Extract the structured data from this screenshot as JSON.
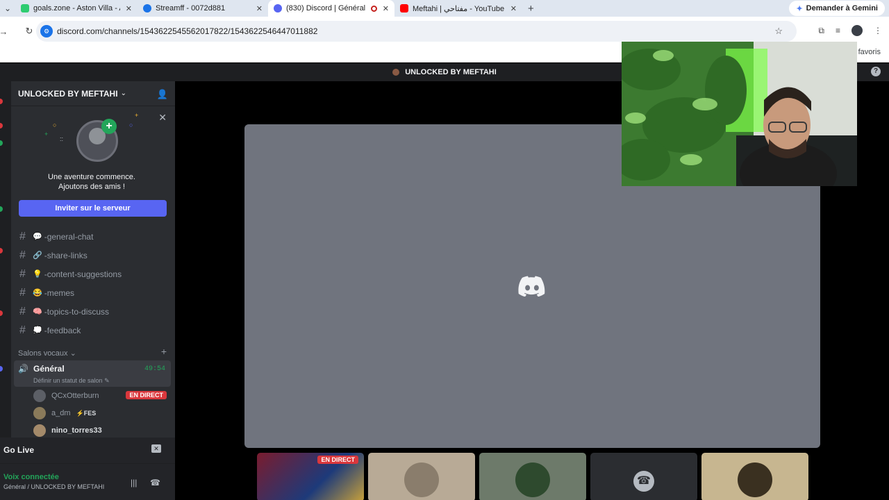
{
  "browser": {
    "tabs": [
      {
        "label": "goals.zone - Aston Villa - Ars",
        "icon": "goals-favicon",
        "color": "#2ecc71",
        "active": false
      },
      {
        "label": "Streamff - 0072d881",
        "icon": "streamff-favicon",
        "color": "#1a73e8",
        "active": false
      },
      {
        "label": "(830) Discord | Général |",
        "icon": "discord-favicon",
        "color": "#5865f2",
        "active": true
      },
      {
        "label": "Meftahi | مفتاحي - YouTube",
        "icon": "youtube-favicon",
        "color": "#ff0000",
        "active": false
      }
    ],
    "gemini_label": "Demander à Gemini",
    "url": "discord.com/channels/1543622545562017822/1543622546447011882",
    "bookmarks_label": "s favoris"
  },
  "discord": {
    "top_title": "UNLOCKED BY MEFTAHI",
    "server_name": "UNLOCKED BY MEFTAHI",
    "promo": {
      "line1": "Une aventure commence.",
      "line2": "Ajoutons des amis !",
      "button": "Inviter sur le serveur"
    },
    "channels": [
      {
        "emoji": "💬",
        "name": "-general-chat"
      },
      {
        "emoji": "🔗",
        "name": "-share-links"
      },
      {
        "emoji": "💡",
        "name": "-content-suggestions"
      },
      {
        "emoji": "😂",
        "name": "-memes"
      },
      {
        "emoji": "🧠",
        "name": "-topics-to-discuss"
      },
      {
        "emoji": "💭",
        "name": "-feedback"
      }
    ],
    "voice_category": "Salons vocaux",
    "voice_channel": {
      "name": "Général",
      "time": "49:54",
      "status": "Définir un statut de salon"
    },
    "voice_users": [
      {
        "name": "QCxOtterburn",
        "badge": "EN DIRECT"
      },
      {
        "name": "a_dm",
        "tag": "FES"
      },
      {
        "name": "nino_torres33"
      }
    ],
    "go_live": "Go Live",
    "voice_connected": "Voix connectée",
    "voice_connected_sub": "Général / UNLOCKED BY MEFTAHI",
    "thumb_live_badge": "EN DIRECT"
  },
  "colors": {
    "accent": "#5865f2",
    "online": "#23a55a",
    "live": "#da373c"
  }
}
